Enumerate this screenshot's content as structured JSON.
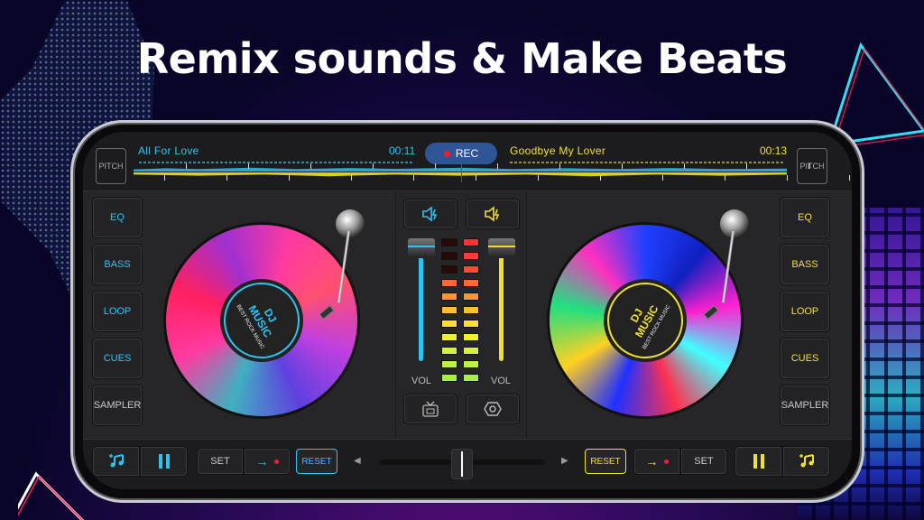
{
  "headline": "Remix sounds & Make Beats",
  "colors": {
    "deck_a": "#2ec4f0",
    "deck_b": "#f0e030",
    "rec_button": "#2e5595",
    "rec_dot": "#f02030"
  },
  "deck_a": {
    "pitch_label": "PITCH",
    "track_title": "All For Love",
    "time": "00:11",
    "side_buttons": [
      "EQ",
      "BASS",
      "LOOP",
      "CUES",
      "SAMPLER"
    ],
    "disc_label": {
      "title_line1": "DJ",
      "title_line2": "MUSIC",
      "subtitle": "BEST ROCK MUSIC"
    },
    "volume_label": "VOL",
    "volume_level": 0.95,
    "add_music_icon": "music-add-icon",
    "pause_icon": "pause-icon",
    "cue_set_label": "SET",
    "cue_go_icon": "arrow-right-icon",
    "reset_label": "RESET"
  },
  "deck_b": {
    "pitch_label": "PITCH",
    "track_title": "Goodbye My Lover",
    "time": "00:13",
    "side_buttons": [
      "EQ",
      "BASS",
      "LOOP",
      "CUES",
      "SAMPLER"
    ],
    "disc_label": {
      "title_line1": "DJ",
      "title_line2": "MUSIC",
      "subtitle": "BEST ROCK MUSIC"
    },
    "volume_label": "VOL",
    "volume_level": 0.95,
    "add_music_icon": "music-add-icon",
    "pause_icon": "pause-icon",
    "cue_set_label": "SET",
    "cue_go_icon": "arrow-right-icon",
    "reset_label": "RESET"
  },
  "rec": {
    "label": "REC"
  },
  "mixer": {
    "speaker_a_icon": "speaker-boost-icon",
    "speaker_b_icon": "speaker-boost-icon",
    "ad_icon": "tv-ad-icon",
    "settings_icon": "hexagon-settings-icon",
    "meter_a_lit_segments": 8,
    "meter_b_lit_segments": 11,
    "meter_segments": 11
  },
  "crossfader": {
    "position": 0.5
  }
}
